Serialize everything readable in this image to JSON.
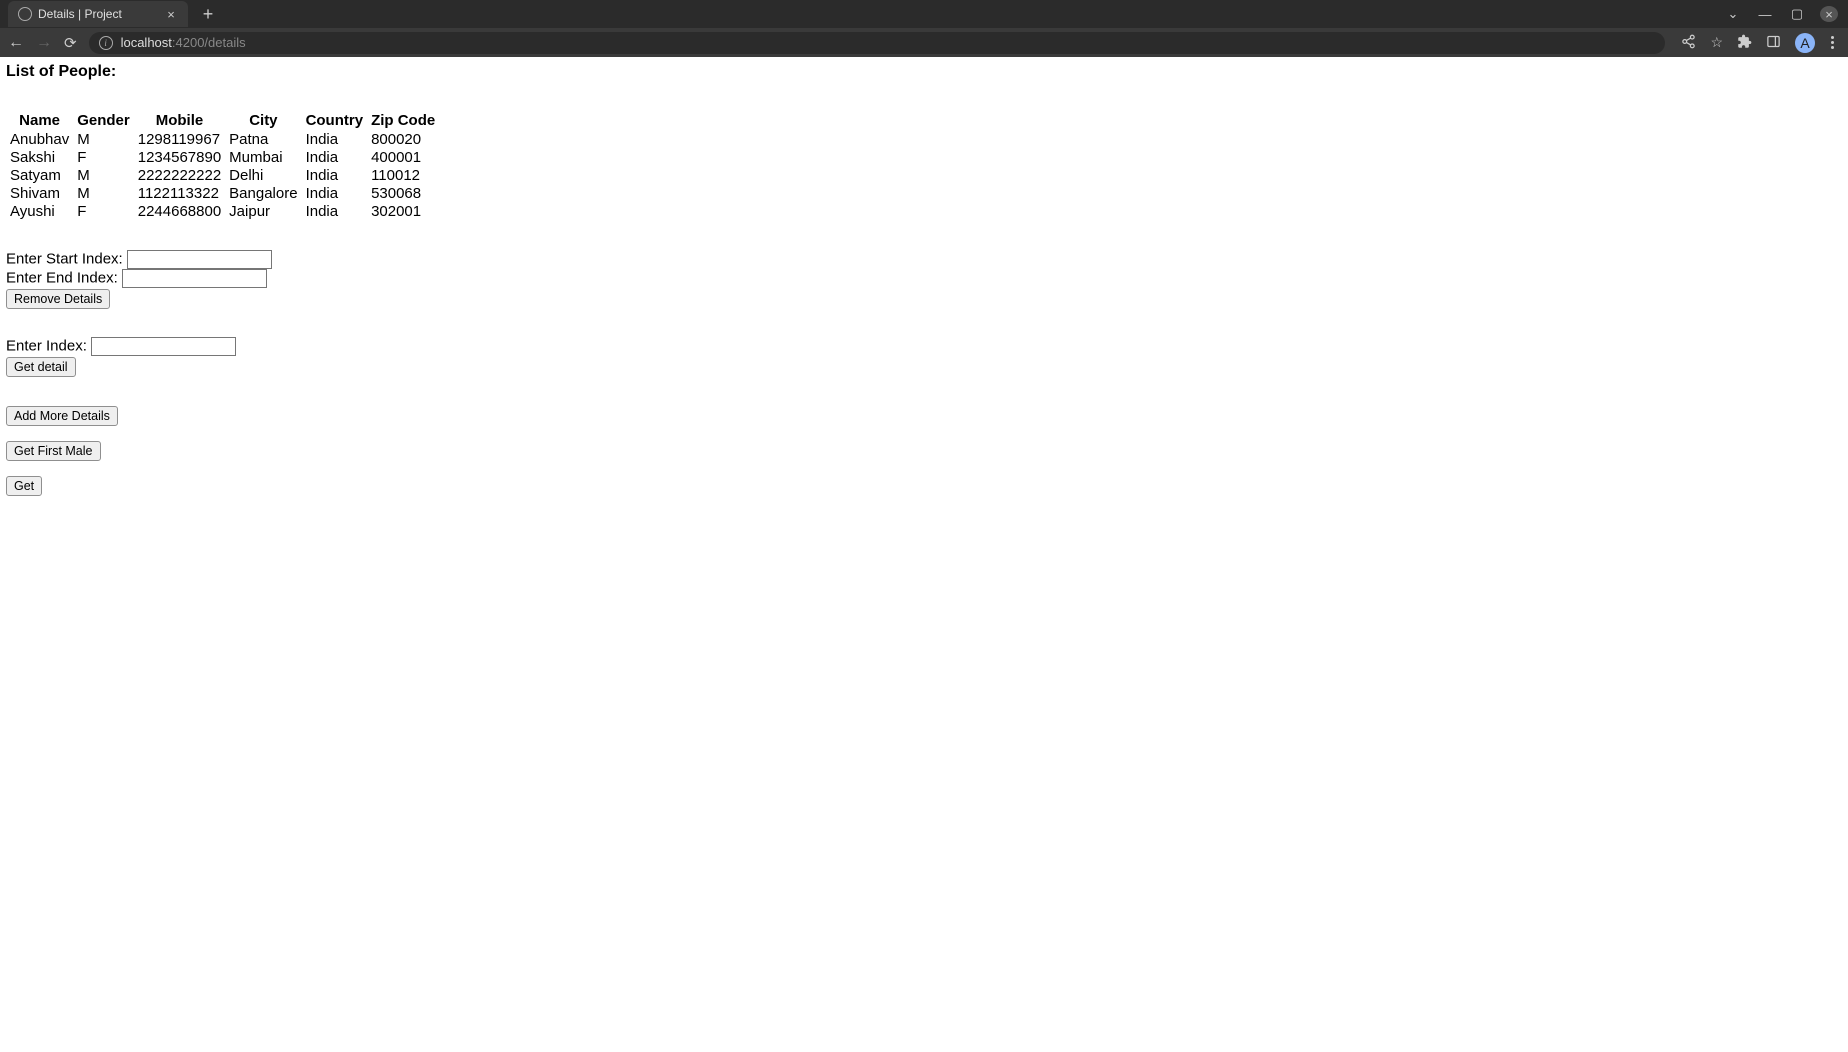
{
  "browser": {
    "tab_title": "Details | Project",
    "url_host": "localhost",
    "url_port_path": ":4200/details",
    "avatar_letter": "A"
  },
  "page": {
    "title": "List of People:",
    "table": {
      "headers": [
        "Name",
        "Gender",
        "Mobile",
        "City",
        "Country",
        "Zip Code"
      ],
      "rows": [
        {
          "name": "Anubhav",
          "gender": "M",
          "mobile": "1298119967",
          "city": "Patna",
          "country": "India",
          "zip": "800020"
        },
        {
          "name": "Sakshi",
          "gender": "F",
          "mobile": "1234567890",
          "city": "Mumbai",
          "country": "India",
          "zip": "400001"
        },
        {
          "name": "Satyam",
          "gender": "M",
          "mobile": "2222222222",
          "city": "Delhi",
          "country": "India",
          "zip": "110012"
        },
        {
          "name": "Shivam",
          "gender": "M",
          "mobile": "1122113322",
          "city": "Bangalore",
          "country": "India",
          "zip": "530068"
        },
        {
          "name": "Ayushi",
          "gender": "F",
          "mobile": "2244668800",
          "city": "Jaipur",
          "country": "India",
          "zip": "302001"
        }
      ]
    },
    "labels": {
      "start_index": "Enter Start Index:",
      "end_index": "Enter End Index:",
      "index": "Enter Index:"
    },
    "buttons": {
      "remove_details": "Remove Details",
      "get_detail": "Get detail",
      "add_more": "Add More Details",
      "get_first_male": "Get First Male",
      "get": "Get"
    }
  }
}
